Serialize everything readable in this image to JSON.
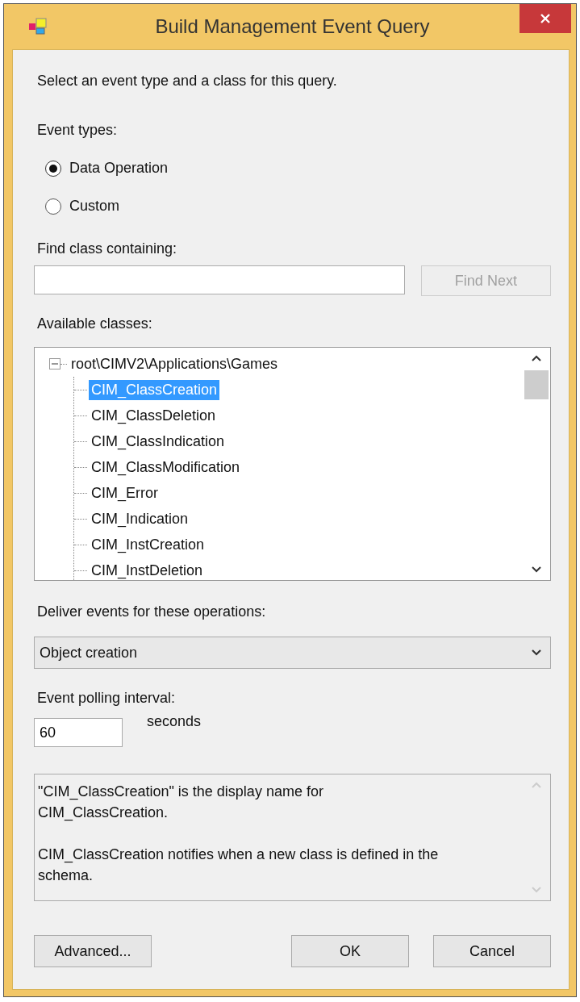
{
  "window": {
    "title": "Build Management Event Query"
  },
  "instruction": "Select an event type and a class for this query.",
  "event_types": {
    "label": "Event types:",
    "options": [
      {
        "label": "Data Operation",
        "selected": true
      },
      {
        "label": "Custom",
        "selected": false
      }
    ]
  },
  "find": {
    "label": "Find class containing:",
    "button": {
      "label": "Find Next",
      "disabled": true
    }
  },
  "classes": {
    "label": "Available classes:",
    "tree": [
      {
        "label": "root\\CIMV2\\Applications\\Games",
        "expanded": true,
        "selected": false,
        "children": [
          {
            "label": "CIM_ClassCreation",
            "selected": true
          },
          {
            "label": "CIM_ClassDeletion",
            "selected": false
          },
          {
            "label": "CIM_ClassIndication",
            "selected": false
          },
          {
            "label": "CIM_ClassModification",
            "selected": false
          },
          {
            "label": "CIM_Error",
            "selected": false
          },
          {
            "label": "CIM_Indication",
            "selected": false
          },
          {
            "label": "CIM_InstCreation",
            "selected": false
          },
          {
            "label": "CIM_InstDeletion",
            "selected": false
          }
        ]
      }
    ]
  },
  "operations": {
    "label": "Deliver events for these operations:",
    "value": "Object creation"
  },
  "interval": {
    "label": "Event polling interval:",
    "value": "60",
    "unit": "seconds"
  },
  "description": [
    "\"CIM_ClassCreation\" is the display name for\nCIM_ClassCreation.",
    "CIM_ClassCreation notifies when a new class is defined in the\nschema."
  ],
  "buttons": [
    {
      "label": "Advanced...",
      "kind": "left"
    },
    {
      "label": "OK",
      "kind": "right"
    },
    {
      "label": "Cancel",
      "kind": "right"
    }
  ]
}
